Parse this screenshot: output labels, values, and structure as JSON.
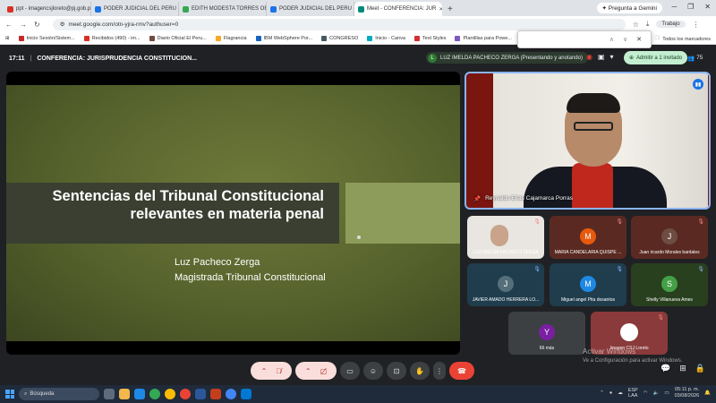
{
  "browser": {
    "tabs": [
      {
        "label": "ppt - imagencsjloreto@pj.gob.pe",
        "color": "#d93025",
        "active": false
      },
      {
        "label": "PODER JUDICIAL DEL PERU - C",
        "color": "#1a73e8",
        "active": false
      },
      {
        "label": "EDITH MODESTA TORRES OBR",
        "color": "#34a853",
        "active": false
      },
      {
        "label": "PODER JUDICIAL DEL PERU - C",
        "color": "#1a73e8",
        "active": false
      },
      {
        "label": "Meet - CONFERENCIA: JUR",
        "color": "#00897b",
        "active": true
      }
    ],
    "new_tab": "+",
    "gemini_label": "Pregunta a Gemini",
    "url": "meet.google.com/otn-yjra-rmv?authuser=0",
    "profile": "Trabajo",
    "bookmarks": [
      {
        "label": "Inicio Sesión/Sistem...",
        "color": "#c62828"
      },
      {
        "label": "Recibidos (490) - im...",
        "color": "#d93025"
      },
      {
        "label": "Diario Oficial El Peru...",
        "color": "#6d4c41"
      },
      {
        "label": "Flagrancia",
        "color": "#f9a825"
      },
      {
        "label": "IBM WebSphere Por...",
        "color": "#1565c0"
      },
      {
        "label": "CONGRESO",
        "color": "#455a64"
      },
      {
        "label": "Inicio - Canva",
        "color": "#00acc1"
      },
      {
        "label": "Text Styles",
        "color": "#d32f2f"
      },
      {
        "label": "Plantillas para Powe...",
        "color": "#7e57c2"
      },
      {
        "label": "sieweb",
        "color": "#1e88e5"
      },
      {
        "label": "Adobe Creat",
        "color": "#e53935"
      }
    ],
    "all_bookmarks": "Todos los marcadores"
  },
  "meet": {
    "time": "17:11",
    "meeting_title": "CONFERENCIA: JURISPRUDENCIA CONSTITUCION...",
    "presenter_initial": "L",
    "presenter_label": "LUZ IMELDA PACHECO ZERGA (Presentando y anotando)",
    "admit_label": "Admitir a 1 invitado",
    "participant_count": "75"
  },
  "slide": {
    "title_line1": "Sentencias del Tribunal Constitucional",
    "title_line2": "relevantes en materia penal",
    "author": "Luz Pacheco Zerga",
    "role": "Magistrada Tribunal Constitucional"
  },
  "main_tile": {
    "name": "Reynaldo Elías Cajamarca Porras"
  },
  "tiles": [
    {
      "name": "LUZ IMELDA PACHECO ZERGA",
      "initial": "",
      "color": "#ffffff",
      "muted": true
    },
    {
      "name": "MARIA CANDELARIA QUISPE ...",
      "initial": "M",
      "color": "#e8590c",
      "muted": true
    },
    {
      "name": "Juan ricardo Morales bardales",
      "initial": "J",
      "color": "#6d4c41",
      "muted": true
    },
    {
      "name": "JAVIER AMADO HERRERA LÓ...",
      "initial": "J",
      "color": "#546e7a",
      "muted": true
    },
    {
      "name": "Miguel angel Pita dosantos",
      "initial": "M",
      "color": "#1e88e5",
      "muted": true
    },
    {
      "name": "Shelly Villanueva Ames",
      "initial": "S",
      "color": "#43a047",
      "muted": true
    },
    {
      "name": "66 más",
      "initial": "Y",
      "color": "#7b1fa2",
      "muted": false
    },
    {
      "name": "Imagen CSJ Loreto",
      "initial": "",
      "color": "#ffffff",
      "muted": true
    }
  ],
  "watermark": {
    "line1": "Activar Windows",
    "line2": "Ve a Configuración para activar Windows."
  },
  "taskbar": {
    "search": "Búsqueda",
    "lang1": "ESP",
    "lang2": "LAA",
    "time": "05:11 p. m.",
    "date": "03/08/2026"
  }
}
